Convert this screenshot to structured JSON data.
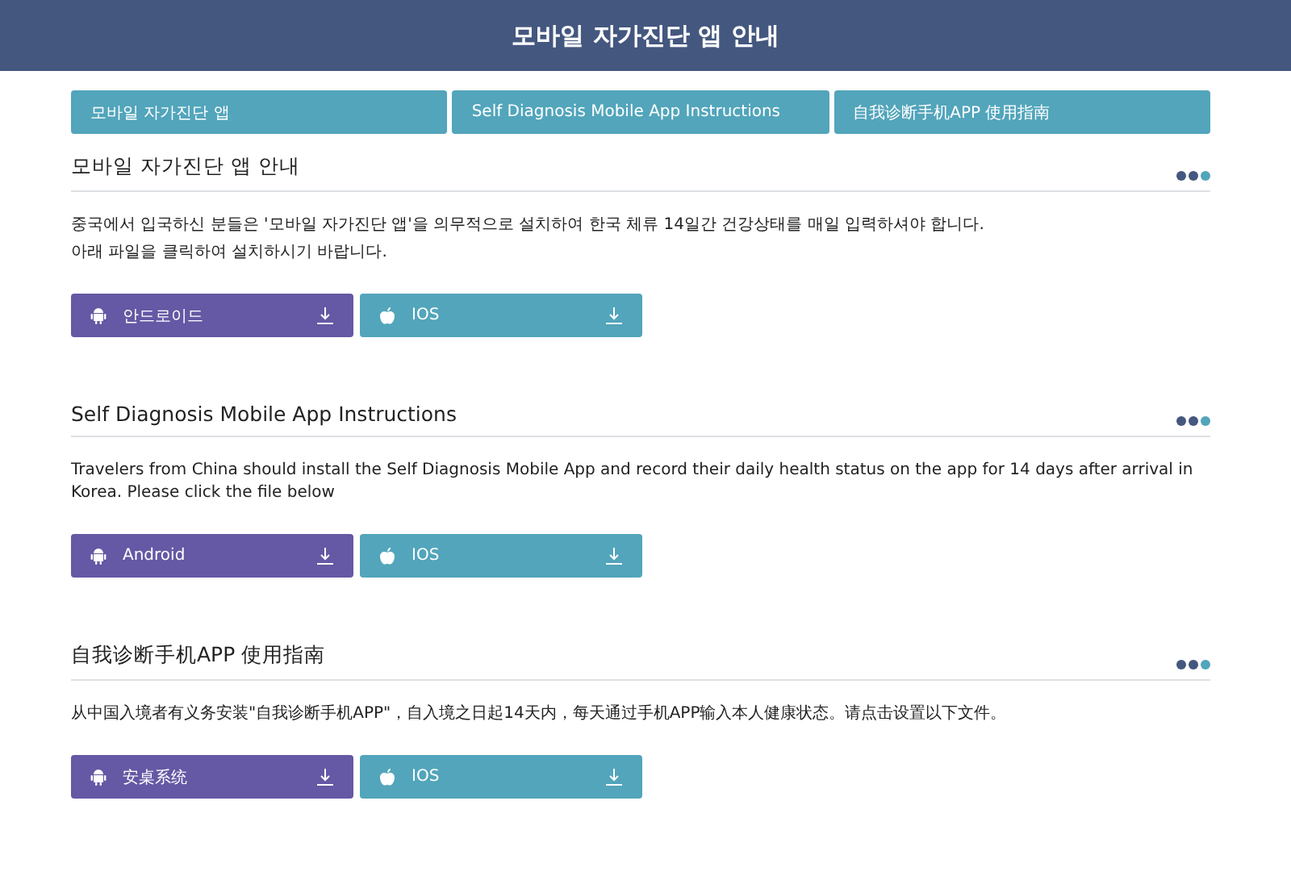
{
  "header": {
    "title": "모바일 자가진단 앱 안내"
  },
  "tabs": [
    {
      "label": "모바일 자가진단 앱"
    },
    {
      "label": "Self Diagnosis Mobile App Instructions"
    },
    {
      "label": "自我诊断手机APP 使用指南"
    }
  ],
  "sections": [
    {
      "title": "모바일 자가진단 앱 안내",
      "paragraphs": [
        "중국에서 입국하신 분들은 '모바일 자가진단 앱'을 의무적으로 설치하여 한국 체류 14일간 건강상태를 매일 입력하셔야 합니다.",
        "아래 파일을 클릭하여 설치하시기 바랍니다."
      ],
      "buttons": [
        {
          "kind": "android",
          "label": "안드로이드"
        },
        {
          "kind": "ios",
          "label": "IOS"
        }
      ]
    },
    {
      "title": "Self Diagnosis Mobile App Instructions",
      "paragraphs": [
        "Travelers from China should install the Self Diagnosis Mobile App and record their daily health status on the app for 14 days after arrival in Korea. Please click the file below"
      ],
      "buttons": [
        {
          "kind": "android",
          "label": "Android"
        },
        {
          "kind": "ios",
          "label": "IOS"
        }
      ]
    },
    {
      "title": "自我诊断手机APP 使用指南",
      "paragraphs": [
        "从中国入境者有义务安装\"自我诊断手机APP\"，自入境之日起14天内，每天通过手机APP输入本人健康状态。请点击设置以下文件。"
      ],
      "buttons": [
        {
          "kind": "android",
          "label": "安桌系统"
        },
        {
          "kind": "ios",
          "label": "IOS"
        }
      ]
    }
  ]
}
